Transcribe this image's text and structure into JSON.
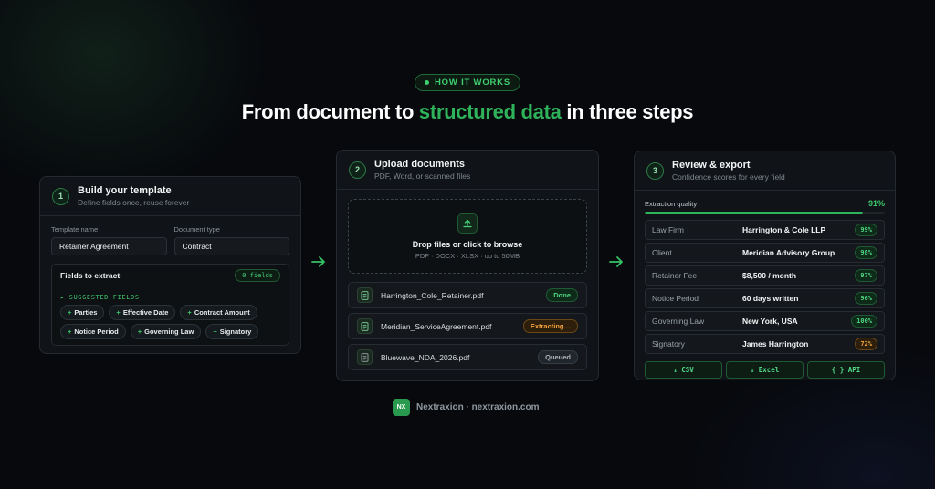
{
  "badge": "HOW IT WORKS",
  "headline": {
    "pre": "From document to ",
    "highlight": "structured data",
    "post": " in three steps"
  },
  "steps": [
    {
      "number": "1",
      "title": "Build your template",
      "subtitle": "Define fields once, reuse forever",
      "template_name_label": "Template name",
      "template_name_value": "Retainer Agreement",
      "document_type_label": "Document type",
      "document_type_value": "Contract",
      "fields_title": "Fields to extract",
      "fields_count": "0 fields",
      "suggested_label": "▸ SUGGESTED FIELDS",
      "chips": [
        "Parties",
        "Effective Date",
        "Contract Amount",
        "Notice Period",
        "Governing Law",
        "Signatory"
      ]
    },
    {
      "number": "2",
      "title": "Upload documents",
      "subtitle": "PDF, Word, or scanned files",
      "drop_title": "Drop files or click to browse",
      "drop_sub": "PDF · DOCX · XLSX · up to 50MB",
      "files": [
        {
          "name": "Harrington_Cole_Retainer.pdf",
          "status": "Done"
        },
        {
          "name": "Meridian_ServiceAgreement.pdf",
          "status": "Extracting…"
        },
        {
          "name": "Bluewave_NDA_2026.pdf",
          "status": "Queued"
        }
      ]
    },
    {
      "number": "3",
      "title": "Review & export",
      "subtitle": "Confidence scores for every field",
      "quality_label": "Extraction quality",
      "quality_value": "91%",
      "quality_fraction": 0.91,
      "rows": [
        {
          "label": "Law Firm",
          "value": "Harrington & Cole LLP",
          "confidence": "99%"
        },
        {
          "label": "Client",
          "value": "Meridian Advisory Group",
          "confidence": "98%"
        },
        {
          "label": "Retainer Fee",
          "value": "$8,500 / month",
          "confidence": "97%"
        },
        {
          "label": "Notice Period",
          "value": "60 days written",
          "confidence": "96%"
        },
        {
          "label": "Governing Law",
          "value": "New York, USA",
          "confidence": "100%"
        },
        {
          "label": "Signatory",
          "value": "James Harrington",
          "confidence": "72%"
        }
      ],
      "exports": [
        "↓ CSV",
        "↓ Excel",
        "{ } API"
      ]
    }
  ],
  "footer": {
    "logo": "NX",
    "text": "Nextraxion · nextraxion.com"
  },
  "colors": {
    "accent": "#2fb35a",
    "warning": "#f2a33c",
    "background": "#07090d"
  },
  "icons": {
    "arrow": "arrow-right-icon",
    "upload": "upload-icon",
    "file": "file-icon"
  }
}
